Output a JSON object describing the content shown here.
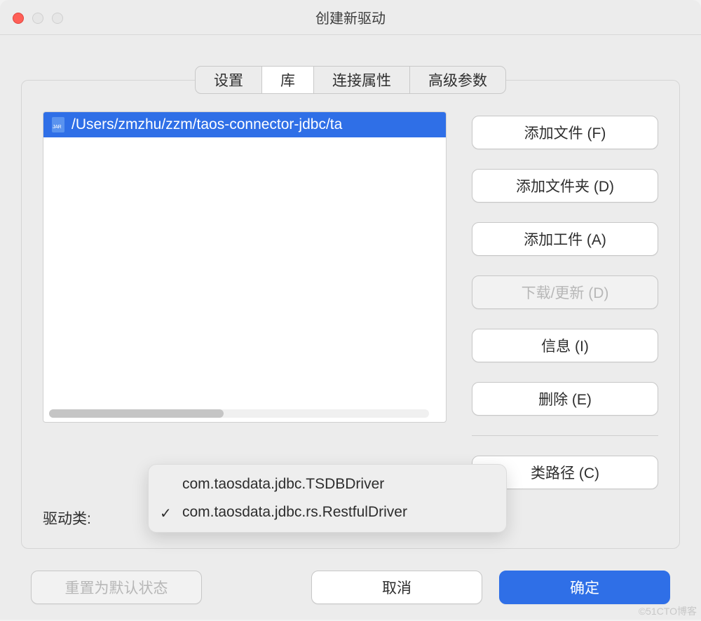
{
  "window": {
    "title": "创建新驱动"
  },
  "tabs": {
    "settings": "设置",
    "library": "库",
    "conn_props": "连接属性",
    "advanced": "高级参数"
  },
  "library": {
    "items": [
      {
        "path": "/Users/zmzhu/zzm/taos-connector-jdbc/ta"
      }
    ],
    "driver_class_label": "驱动类:",
    "driver_options": [
      {
        "value": "com.taosdata.jdbc.TSDBDriver",
        "selected": false
      },
      {
        "value": "com.taosdata.jdbc.rs.RestfulDriver",
        "selected": true
      }
    ]
  },
  "buttons": {
    "add_file": "添加文件 (F)",
    "add_folder": "添加文件夹 (D)",
    "add_artifact": "添加工件 (A)",
    "download_update": "下载/更新 (D)",
    "info": "信息 (I)",
    "delete": "删除 (E)",
    "classpath": "类路径 (C)"
  },
  "footer": {
    "reset": "重置为默认状态",
    "cancel": "取消",
    "ok": "确定"
  },
  "watermark": "©51CTO博客"
}
